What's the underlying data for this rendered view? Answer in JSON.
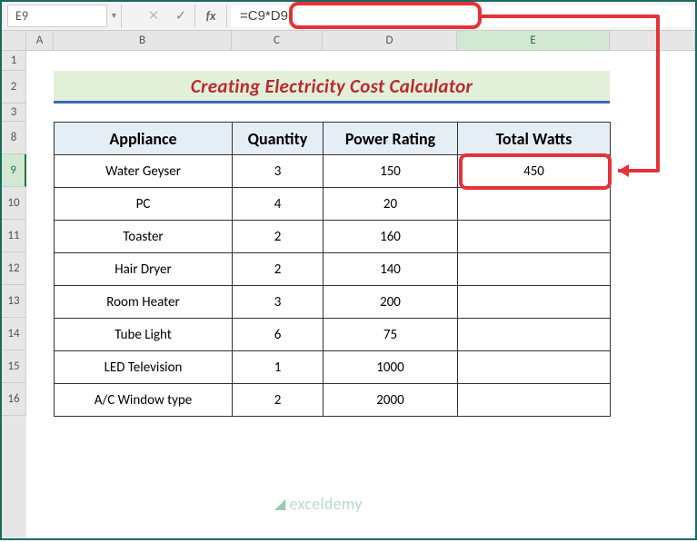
{
  "formula_bar": {
    "name_box": "E9",
    "fx_label": "fx",
    "formula": "=C9*D9"
  },
  "columns": {
    "A": "A",
    "B": "B",
    "C": "C",
    "D": "D",
    "E": "E"
  },
  "rows_visible": [
    "1",
    "2",
    "3",
    "8",
    "9",
    "10",
    "11",
    "12",
    "13",
    "14",
    "15",
    "16"
  ],
  "title": "Creating Electricity Cost Calculator",
  "headers": {
    "appliance": "Appliance",
    "quantity": "Quantity",
    "power_rating": "Power Rating",
    "total_watts": "Total Watts"
  },
  "table": [
    {
      "appliance": "Water Geyser",
      "quantity": "3",
      "power_rating": "150",
      "total_watts": "450"
    },
    {
      "appliance": "PC",
      "quantity": "4",
      "power_rating": "20",
      "total_watts": ""
    },
    {
      "appliance": "Toaster",
      "quantity": "2",
      "power_rating": "160",
      "total_watts": ""
    },
    {
      "appliance": "Hair Dryer",
      "quantity": "2",
      "power_rating": "140",
      "total_watts": ""
    },
    {
      "appliance": "Room Heater",
      "quantity": "3",
      "power_rating": "200",
      "total_watts": ""
    },
    {
      "appliance": "Tube Light",
      "quantity": "6",
      "power_rating": "75",
      "total_watts": ""
    },
    {
      "appliance": "LED Television",
      "quantity": "1",
      "power_rating": "1000",
      "total_watts": ""
    },
    {
      "appliance": "A/C Window type",
      "quantity": "2",
      "power_rating": "2000",
      "total_watts": ""
    }
  ],
  "watermark": "exceldemy",
  "colors": {
    "accent_green": "#217346",
    "highlight_red": "#e53238",
    "title_red": "#b92a2e",
    "title_bg": "#e2f0d9",
    "title_underline": "#3a66b5",
    "header_bg": "#e6eef5"
  }
}
